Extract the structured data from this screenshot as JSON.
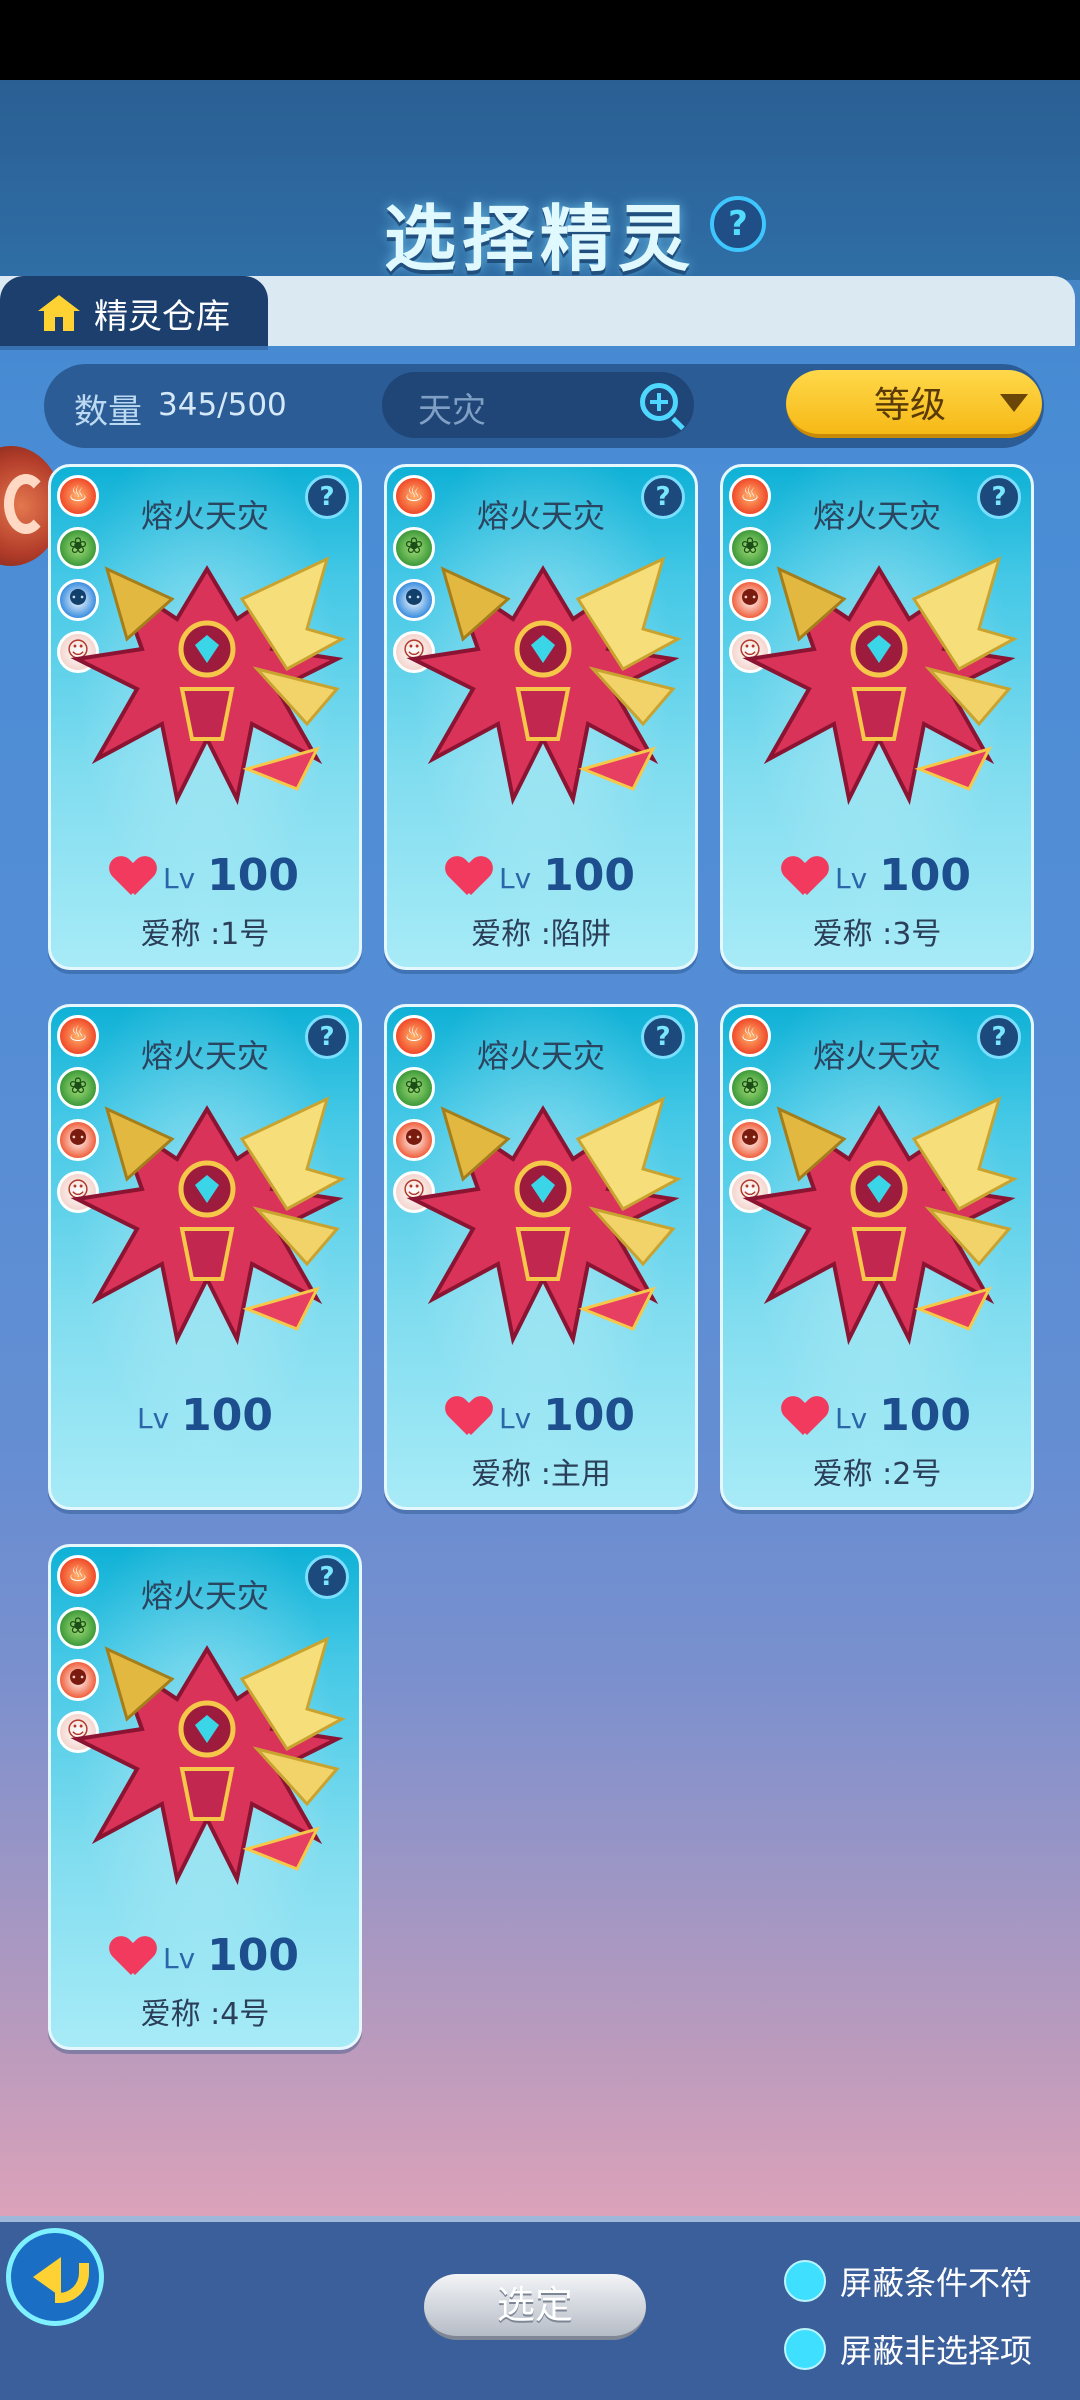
{
  "header": {
    "title": "选择精灵",
    "help": "?"
  },
  "tabs": {
    "active_label": "精灵仓库"
  },
  "toolbar": {
    "count_label": "数量",
    "count_value": "345/500",
    "search_text": "天灾",
    "sort_label": "等级"
  },
  "cards": [
    {
      "name": "熔火天灾",
      "help": "?",
      "badges": [
        "fire",
        "turtle",
        "pet-blue",
        "face"
      ],
      "has_heart": true,
      "lv_label": "Lv",
      "level": "100",
      "nickname": "爱称 :1号"
    },
    {
      "name": "熔火天灾",
      "help": "?",
      "badges": [
        "fire",
        "turtle",
        "pet-blue",
        "face"
      ],
      "has_heart": true,
      "lv_label": "Lv",
      "level": "100",
      "nickname": "爱称 :陷阱"
    },
    {
      "name": "熔火天灾",
      "help": "?",
      "badges": [
        "fire",
        "turtle",
        "pet-red",
        "face"
      ],
      "has_heart": true,
      "lv_label": "Lv",
      "level": "100",
      "nickname": "爱称 :3号"
    },
    {
      "name": "熔火天灾",
      "help": "?",
      "badges": [
        "fire",
        "turtle",
        "pet-red",
        "face"
      ],
      "has_heart": false,
      "lv_label": "Lv",
      "level": "100",
      "nickname": ""
    },
    {
      "name": "熔火天灾",
      "help": "?",
      "badges": [
        "fire",
        "turtle",
        "pet-red",
        "face"
      ],
      "has_heart": true,
      "lv_label": "Lv",
      "level": "100",
      "nickname": "爱称 :主用"
    },
    {
      "name": "熔火天灾",
      "help": "?",
      "badges": [
        "fire",
        "turtle",
        "pet-red",
        "face"
      ],
      "has_heart": true,
      "lv_label": "Lv",
      "level": "100",
      "nickname": "爱称 :2号"
    },
    {
      "name": "熔火天灾",
      "help": "?",
      "badges": [
        "fire",
        "turtle",
        "pet-red",
        "face"
      ],
      "has_heart": true,
      "lv_label": "Lv",
      "level": "100",
      "nickname": "爱称 :4号"
    }
  ],
  "footer": {
    "select_label": "选定",
    "filter_mismatch": "屏蔽条件不符",
    "filter_nonselect": "屏蔽非选择项"
  },
  "colors": {
    "accent_yellow": "#f6b916",
    "cyan": "#3fe0ff",
    "heart": "#f23a5e"
  }
}
